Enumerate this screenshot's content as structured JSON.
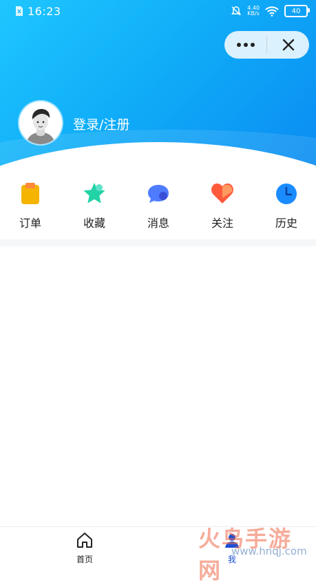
{
  "status_bar": {
    "time": "16:23",
    "net_speed_value": "4.40",
    "net_speed_unit": "KB/s",
    "battery": "40"
  },
  "capsule": {
    "more_icon": "more-dots-icon",
    "close_icon": "close-icon"
  },
  "profile": {
    "login_label": "登录/注册",
    "avatar_icon": "avatar-icon"
  },
  "menu": {
    "items": [
      {
        "label": "订单",
        "icon": "order-icon",
        "color": "#f5b400"
      },
      {
        "label": "收藏",
        "icon": "star-icon",
        "color": "#22d3a6"
      },
      {
        "label": "消息",
        "icon": "message-icon",
        "color": "#4f7cff"
      },
      {
        "label": "关注",
        "icon": "heart-icon",
        "color": "#ff5a3c"
      },
      {
        "label": "历史",
        "icon": "clock-icon",
        "color": "#1a8cff"
      }
    ]
  },
  "tabbar": {
    "tabs": [
      {
        "label": "首页",
        "icon": "home-icon",
        "active": false
      },
      {
        "label": "我",
        "icon": "profile-icon",
        "active": true
      }
    ]
  },
  "watermark": {
    "text": "火鸟手游网",
    "url": "www.hnqj.com"
  },
  "colors": {
    "header_start": "#1fc6ff",
    "header_end": "#0a8cf2",
    "accent": "#1a4fd6"
  }
}
